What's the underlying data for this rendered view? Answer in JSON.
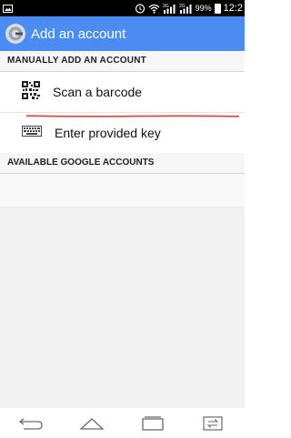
{
  "status_bar": {
    "battery_percent": "99%",
    "time": "12:2",
    "icons": [
      "notification-icon",
      "alarm-icon",
      "wifi-icon",
      "signal-sim1-icon",
      "signal-sim2-icon",
      "battery-icon"
    ],
    "sim1_label": "3G",
    "sim2_label": "2G"
  },
  "app_bar": {
    "title": "Add an account",
    "color": "#4a8cf2"
  },
  "manual_section": {
    "header": "MANUALLY ADD AN ACCOUNT",
    "options": [
      {
        "label": "Scan a barcode",
        "icon": "qr-code-icon"
      },
      {
        "label": "Enter provided key",
        "icon": "keyboard-icon"
      }
    ]
  },
  "accounts_section": {
    "header": "AVAILABLE GOOGLE ACCOUNTS"
  },
  "annotation": {
    "underline_color": "#e53935"
  },
  "nav_bar": {
    "buttons": [
      "back-icon",
      "home-icon",
      "recent-apps-icon",
      "switch-sim-icon"
    ]
  }
}
